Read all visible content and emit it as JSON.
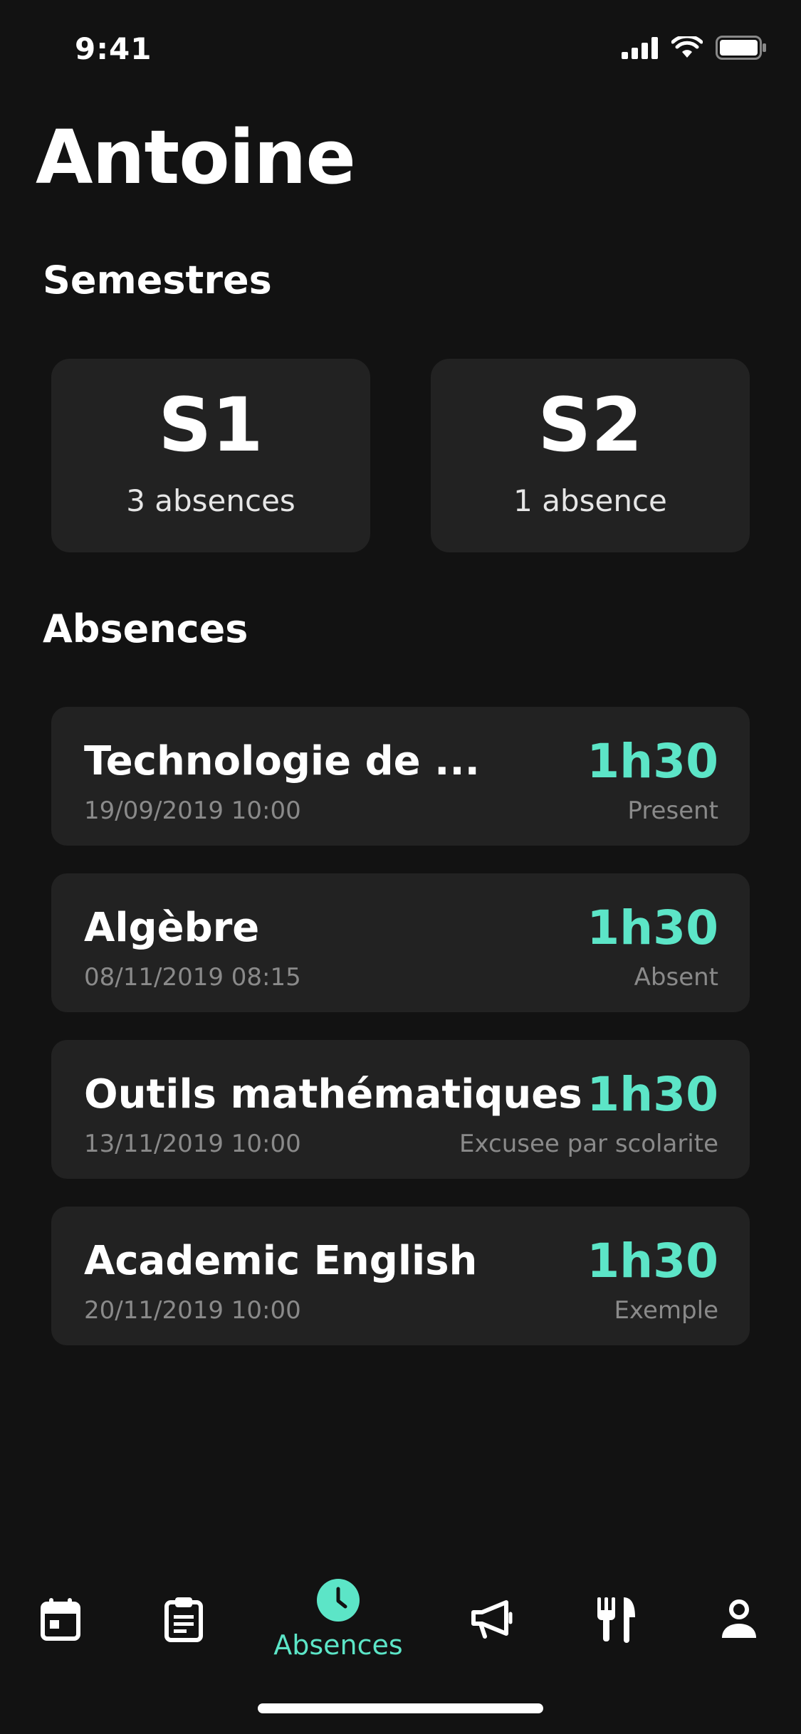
{
  "status_bar": {
    "time": "9:41"
  },
  "page": {
    "title": "Antoine"
  },
  "semesters": {
    "section_title": "Semestres",
    "items": [
      {
        "name": "S1",
        "count": "3 absences"
      },
      {
        "name": "S2",
        "count": "1 absence"
      }
    ]
  },
  "absences": {
    "section_title": "Absences",
    "items": [
      {
        "subject": "Technologie de ...",
        "date": "19/09/2019 10:00",
        "duration": "1h30",
        "status": "Present"
      },
      {
        "subject": "Algèbre",
        "date": "08/11/2019 08:15",
        "duration": "1h30",
        "status": "Absent"
      },
      {
        "subject": "Outils mathématiques",
        "date": "13/11/2019 10:00",
        "duration": "1h30",
        "status": "Excusee par scolarite"
      },
      {
        "subject": "Academic English",
        "date": "20/11/2019 10:00",
        "duration": "1h30",
        "status": "Exemple"
      }
    ]
  },
  "tab_bar": {
    "tabs": [
      {
        "icon": "calendar-icon"
      },
      {
        "icon": "clipboard-icon"
      },
      {
        "icon": "clock-icon",
        "label": "Absences",
        "active": true
      },
      {
        "icon": "megaphone-icon"
      },
      {
        "icon": "fork-knife-icon"
      },
      {
        "icon": "person-icon"
      }
    ]
  },
  "colors": {
    "accent": "#5ce5c7",
    "background": "#121212",
    "card": "#222222",
    "muted_text": "#8a8a8a"
  }
}
